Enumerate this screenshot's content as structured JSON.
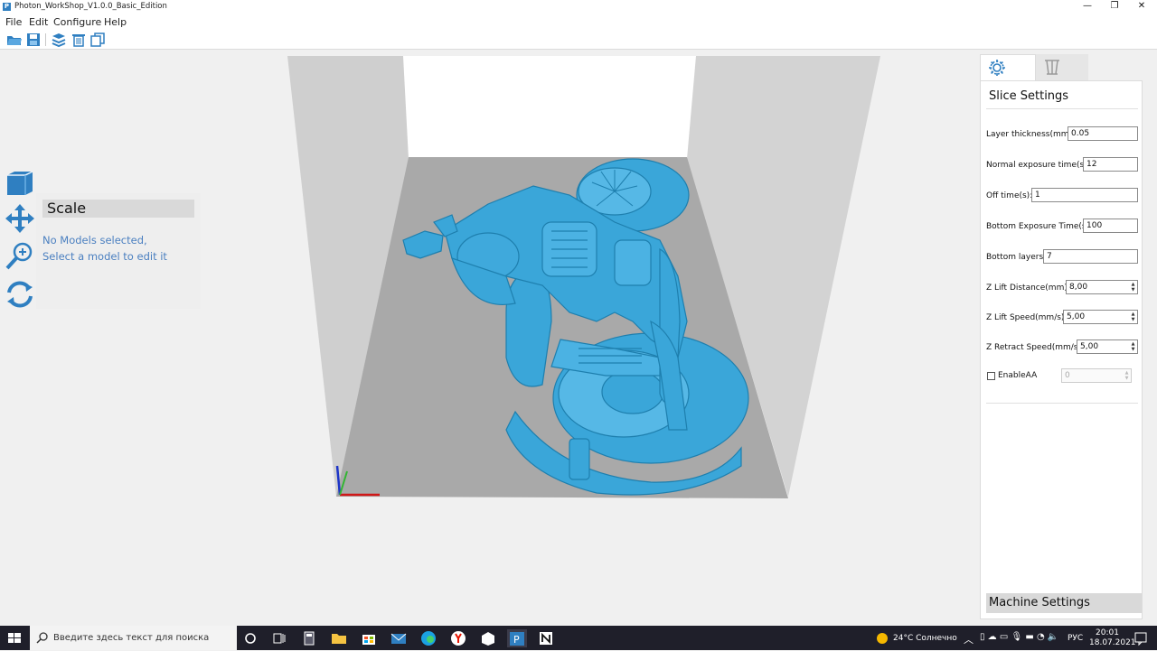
{
  "window": {
    "title": "Photon_WorkShop_V1.0.0_Basic_Edition",
    "app_icon_letter": "P",
    "controls": {
      "minimize": "—",
      "restore": "❐",
      "close": "✕"
    }
  },
  "menu": {
    "items": [
      "File",
      "Edit",
      "Configure",
      "Help"
    ]
  },
  "toolbar": {
    "icons": [
      "open-folder-icon",
      "save-icon",
      "slice-layers-icon",
      "delete-icon",
      "copy-icon"
    ]
  },
  "left_tools": {
    "icons": [
      "cube-view-icon",
      "move-icon",
      "scale-icon",
      "rotate-icon"
    ]
  },
  "scale_panel": {
    "title": "Scale",
    "message_line1": "No Models selected,",
    "message_line2": "Select a model to edit it"
  },
  "settings": {
    "tabs": [
      "gear-icon",
      "supports-icon"
    ],
    "title": "Slice Settings",
    "fields": [
      {
        "label": "Layer thickness(mm):",
        "value": "0.05"
      },
      {
        "label": "Normal exposure time(s):",
        "value": "12"
      },
      {
        "label": "Off time(s):",
        "value": "1"
      },
      {
        "label": "Bottom Exposure Time(s):",
        "value": "100"
      },
      {
        "label": "Bottom layers:",
        "value": "7"
      },
      {
        "label": "Z Lift Distance(mm):",
        "value": "8,00"
      },
      {
        "label": "Z Lift Speed(mm/s):",
        "value": "5,00"
      },
      {
        "label": "Z Retract Speed(mm/s):",
        "value": "5,00"
      }
    ],
    "anti_alias": {
      "label": "EnableAA",
      "checked": false,
      "value": "0"
    },
    "machine_settings": "Machine Settings"
  },
  "taskbar": {
    "search_placeholder": "Введите здесь текст для поиска",
    "weather": "24°C  Солнечно",
    "language": "РУС",
    "time": "20:01",
    "date": "18.07.2021"
  },
  "colors": {
    "model": "#3aa6d9",
    "plate": "#a9a9a9",
    "wall": "#cdcdcd",
    "accent": "#2f7fc1"
  }
}
